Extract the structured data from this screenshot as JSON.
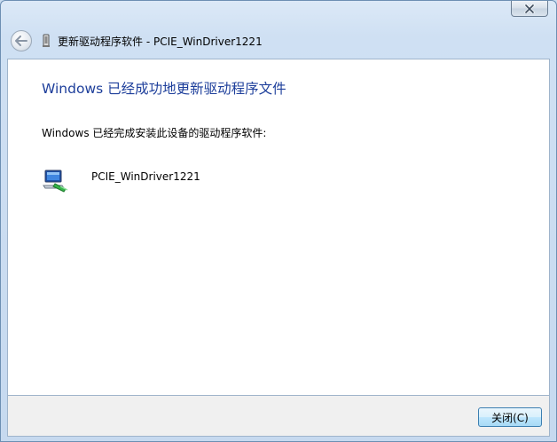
{
  "window": {
    "title_bar_text": "更新驱动程序软件 - PCIE_WinDriver1221",
    "close_icon": "close-icon",
    "back_icon": "back-arrow-icon",
    "title_icon": "device-manager-icon"
  },
  "main": {
    "heading": "Windows 已经成功地更新驱动程序文件",
    "status": "Windows 已经完成安装此设备的驱动程序软件:",
    "device": {
      "name": "PCIE_WinDriver1221",
      "icon": "network-device-icon"
    }
  },
  "footer": {
    "close_button_label": "关闭(C)"
  },
  "colors": {
    "heading": "#1e3f9b",
    "chrome": "#c9dcf0",
    "content_bg": "#ffffff",
    "footer_bg": "#f0f0f0"
  }
}
